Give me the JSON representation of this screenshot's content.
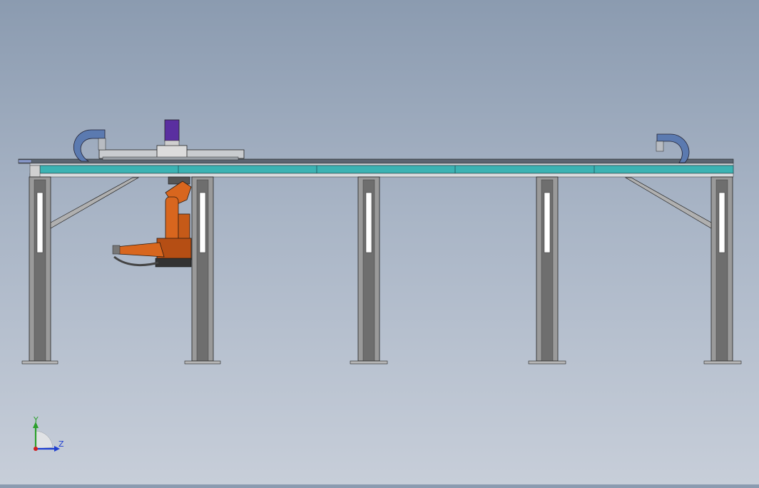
{
  "view": {
    "background_top": "#8b9bb0",
    "background_bottom": "#c7ced9"
  },
  "triad": {
    "y_label": "Y",
    "z_label": "Z",
    "y_color": "#2ca02c",
    "z_color": "#1f3fd0",
    "origin_color": "#d02020"
  },
  "model": {
    "rail_color": "#3bb3b3",
    "steel_color": "#8a8a8a",
    "robot_color": "#d8661e",
    "cable_carrier_color": "#5b7ab0",
    "motor_color": "#5a2fa0",
    "column_count": 5
  }
}
